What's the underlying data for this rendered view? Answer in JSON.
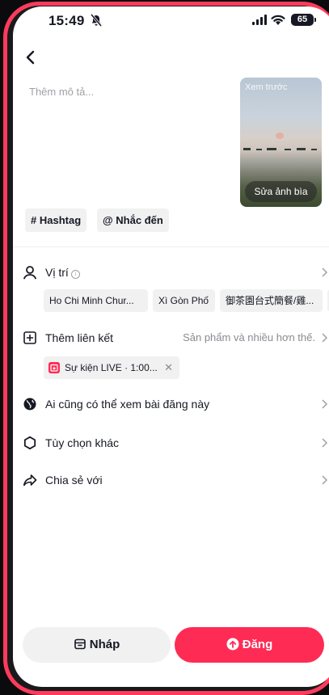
{
  "status_bar": {
    "time": "15:49",
    "battery": "65"
  },
  "description": {
    "placeholder": "Thêm mô tả..."
  },
  "cover": {
    "preview_label": "Xem trước",
    "edit_label": "Sửa ảnh bìa"
  },
  "tags": {
    "hashtag_label": "# Hashtag",
    "mention_label": "@ Nhắc đến"
  },
  "location": {
    "label": "Vị trí",
    "suggestions": [
      "Ho Chi Minh Chur...",
      "Xì Gòn Phố",
      "御茶園台式簡餐/雞..."
    ]
  },
  "add_link": {
    "label": "Thêm liên kết",
    "hint": "Sản phẩm và nhiều hơn thế.",
    "attached": "Sự kiện LIVE · 1:00..."
  },
  "privacy": {
    "label": "Ai cũng có thể xem bài đăng này"
  },
  "more_options": {
    "label": "Tùy chọn khác"
  },
  "share_with": {
    "label": "Chia sẻ với"
  },
  "actions": {
    "draft_label": "Nháp",
    "post_label": "Đăng"
  },
  "colors": {
    "accent": "#fe2c55",
    "frame": "#ff3b5c",
    "chip_bg": "#f1f1f2"
  }
}
